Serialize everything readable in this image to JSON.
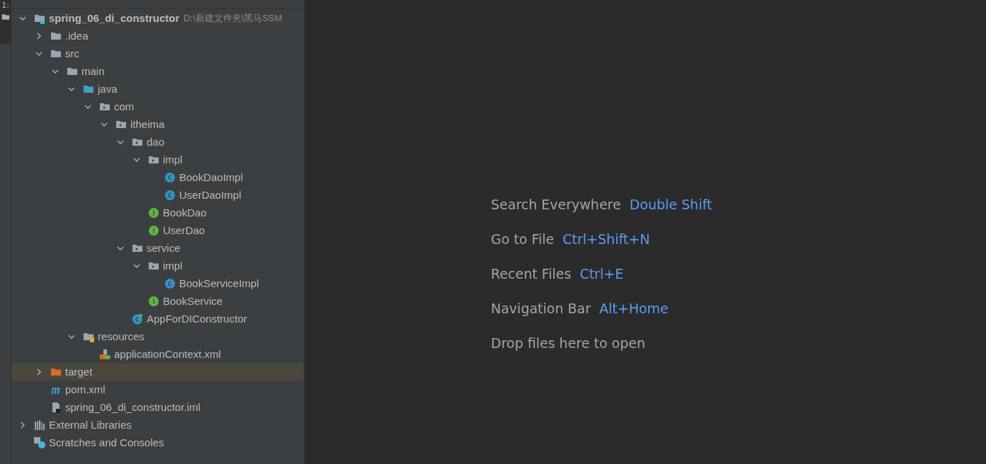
{
  "side_strip": {
    "tab": "1:"
  },
  "tree": [
    {
      "kind": "module",
      "label": "spring_06_di_constructor",
      "path": "D:\\新建文件夹\\黑马SSM",
      "expanded": true,
      "selected": false,
      "children": [
        {
          "kind": "folder",
          "label": ".idea",
          "expanded": false,
          "selected": false
        },
        {
          "kind": "folder",
          "label": "src",
          "expanded": true,
          "selected": false,
          "children": [
            {
              "kind": "folder",
              "label": "main",
              "expanded": true,
              "selected": false,
              "children": [
                {
                  "kind": "source",
                  "label": "java",
                  "expanded": true,
                  "selected": false,
                  "children": [
                    {
                      "kind": "package",
                      "label": "com",
                      "expanded": true,
                      "selected": false,
                      "children": [
                        {
                          "kind": "package",
                          "label": "itheima",
                          "expanded": true,
                          "selected": false,
                          "children": [
                            {
                              "kind": "package",
                              "label": "dao",
                              "expanded": true,
                              "selected": false,
                              "children": [
                                {
                                  "kind": "package",
                                  "label": "impl",
                                  "expanded": true,
                                  "selected": false,
                                  "children": [
                                    {
                                      "kind": "class",
                                      "label": "BookDaoImpl",
                                      "selected": false
                                    },
                                    {
                                      "kind": "class",
                                      "label": "UserDaoImpl",
                                      "selected": false
                                    }
                                  ]
                                },
                                {
                                  "kind": "interface",
                                  "label": "BookDao",
                                  "selected": false
                                },
                                {
                                  "kind": "interface",
                                  "label": "UserDao",
                                  "selected": false
                                }
                              ]
                            },
                            {
                              "kind": "package",
                              "label": "service",
                              "expanded": true,
                              "selected": false,
                              "children": [
                                {
                                  "kind": "package",
                                  "label": "impl",
                                  "expanded": true,
                                  "selected": false,
                                  "children": [
                                    {
                                      "kind": "class",
                                      "label": "BookServiceImpl",
                                      "selected": false
                                    }
                                  ]
                                },
                                {
                                  "kind": "interface",
                                  "label": "BookService",
                                  "selected": false
                                }
                              ]
                            },
                            {
                              "kind": "mainclass",
                              "label": "AppForDIConstructor",
                              "selected": false
                            }
                          ]
                        }
                      ]
                    }
                  ]
                },
                {
                  "kind": "resources",
                  "label": "resources",
                  "expanded": true,
                  "selected": false,
                  "children": [
                    {
                      "kind": "xml",
                      "label": "applicationContext.xml",
                      "selected": false
                    }
                  ]
                }
              ]
            }
          ]
        },
        {
          "kind": "target",
          "label": "target",
          "expanded": false,
          "selected": true
        },
        {
          "kind": "maven",
          "label": "pom.xml",
          "selected": false
        },
        {
          "kind": "iml",
          "label": "spring_06_di_constructor.iml",
          "selected": false
        }
      ]
    },
    {
      "kind": "libraries",
      "label": "External Libraries",
      "expanded": false,
      "selected": false
    },
    {
      "kind": "scratches",
      "label": "Scratches and Consoles",
      "selected": false
    }
  ],
  "hints": [
    {
      "label": "Search Everywhere",
      "shortcut": "Double Shift"
    },
    {
      "label": "Go to File",
      "shortcut": "Ctrl+Shift+N"
    },
    {
      "label": "Recent Files",
      "shortcut": "Ctrl+E"
    },
    {
      "label": "Navigation Bar",
      "shortcut": "Alt+Home"
    },
    {
      "label": "Drop files here to open"
    }
  ]
}
